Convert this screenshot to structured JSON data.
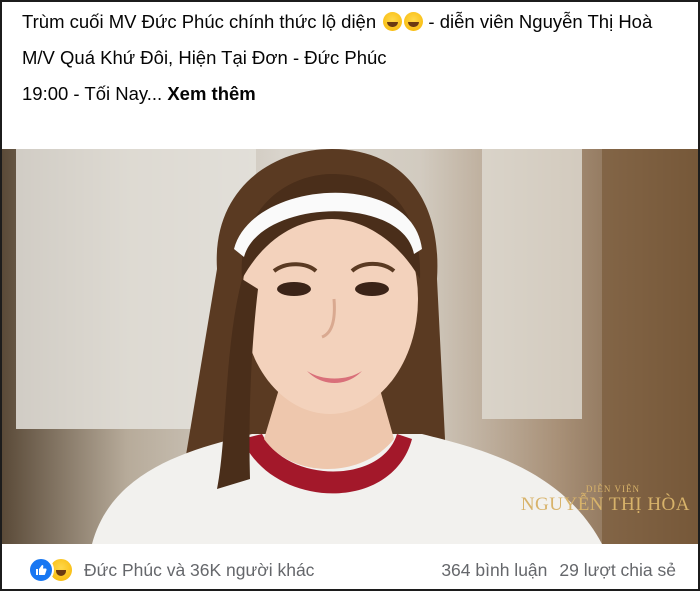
{
  "post": {
    "line1": "Trùm cuối MV Đức Phúc chính thức lộ diện",
    "line1_suffix": " - diễn viên Nguyễn Thị Hoà",
    "line2": "M/V Quá Khứ Đôi, Hiện Tại Đơn - Đức Phúc",
    "line3": "19:00 - Tối Nay...",
    "see_more": "Xem thêm"
  },
  "media": {
    "caption_small": "DIỄN VIÊN",
    "caption_big": "NGUYỄN THỊ HÒA"
  },
  "footer": {
    "reactions": [
      "like-icon",
      "haha-icon"
    ],
    "names": "Đức Phúc và 36K người khác",
    "comments": "364 bình luận",
    "shares": "29 lượt chia sẻ"
  }
}
